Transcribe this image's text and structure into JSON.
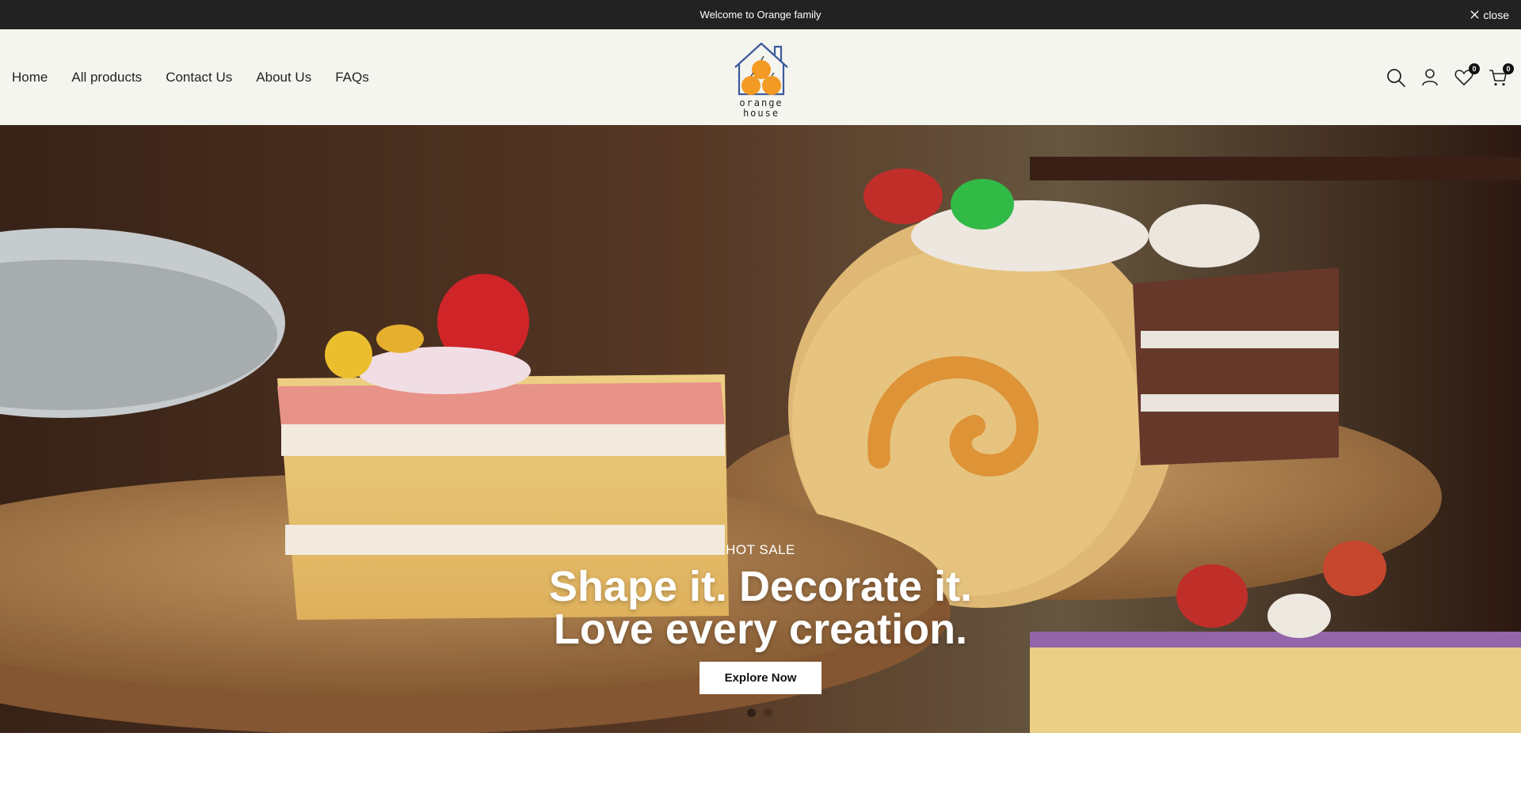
{
  "announcement": {
    "text": "Welcome to Orange family",
    "close_label": "close"
  },
  "nav": {
    "items": [
      {
        "label": "Home"
      },
      {
        "label": "All products"
      },
      {
        "label": "Contact Us"
      },
      {
        "label": "About Us"
      },
      {
        "label": "FAQs"
      }
    ]
  },
  "logo": {
    "line1": "orange",
    "line2": "house",
    "colors": {
      "orange": "#f29a24",
      "outline": "#3a5a9a"
    }
  },
  "header_icons": {
    "search": "search-icon",
    "account": "user-icon",
    "wishlist": "heart-icon",
    "wishlist_count": "0",
    "cart": "cart-icon",
    "cart_count": "0"
  },
  "hero": {
    "subtitle": "HOT SALE",
    "title_line1": "Shape it. Decorate it.",
    "title_line2": "Love every creation.",
    "button_label": "Explore Now",
    "slides": 2,
    "active_slide": 1
  }
}
